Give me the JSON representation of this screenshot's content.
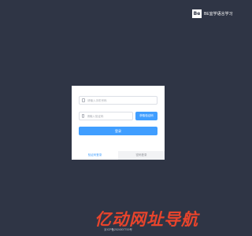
{
  "brand": {
    "logo_text": "Be",
    "name": "BE宜学语言学习"
  },
  "login_form": {
    "phone_placeholder": "请输入手机号码",
    "code_placeholder": "请输入验证码",
    "send_code_label": "获取验证码",
    "login_label": "登录"
  },
  "tabs": [
    {
      "label": "验证码登录",
      "active": true
    },
    {
      "label": "密码登录",
      "active": false
    }
  ],
  "watermark": "亿动网址导航",
  "footer": {
    "icp": "京ICP备2024007700号"
  },
  "colors": {
    "background": "#2f3545",
    "primary": "#409eff",
    "watermark": "#e8442c"
  },
  "icons": {
    "phone": "phone-icon",
    "code": "shield-icon"
  }
}
